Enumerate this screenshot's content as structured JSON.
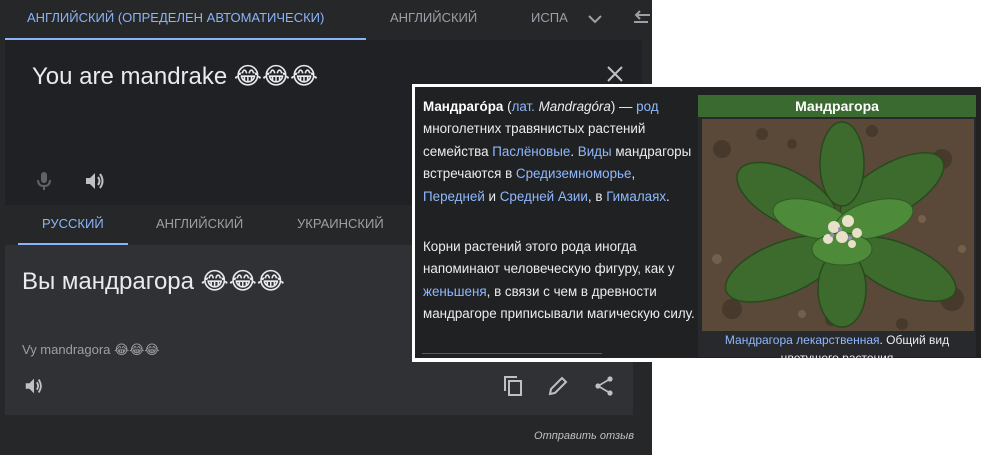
{
  "source_tabs": [
    {
      "label": "АНГЛИЙСКИЙ (ОПРЕДЕЛЕН АВТОМАТИЧЕСКИ)",
      "active": true
    },
    {
      "label": "АНГЛИЙСКИЙ",
      "active": false
    },
    {
      "label": "ИСПА",
      "active": false
    }
  ],
  "source_text": "You are mandrake 😂😂😂",
  "target_tabs": [
    {
      "label": "РУССКИЙ",
      "active": true
    },
    {
      "label": "АНГЛИЙСКИЙ",
      "active": false
    },
    {
      "label": "УКРАИНСКИЙ",
      "active": false
    }
  ],
  "translation_text": "Вы мандрагора 😂😂😂",
  "transliteration": "Vy mandragora 😂😂😂",
  "feedback_link": "Отправить отзыв",
  "wiki": {
    "p1": {
      "term": "Мандрагóра",
      "lat_open": " (",
      "lat_link": "лат.",
      "lat_term": " Mandragóra",
      "lat_close": ") — ",
      "genus_link": "род",
      "text1": " многолетних травянистых растений семейства ",
      "family_link": "Паслёновые",
      "text2": ". ",
      "species_link": "Виды",
      "text3": " мандрагоры встречаются в ",
      "region1_link": "Средиземноморье",
      "text4": ", ",
      "region2_link": "Передней",
      "text5": " и ",
      "region3_link": "Средней Азии",
      "text6": ", в ",
      "region4_link": "Гималаях",
      "text7": "."
    },
    "p2": {
      "text1": "Корни растений этого рода иногда напоминают человеческую фигуру, как у ",
      "ginseng_link": "женьшеня",
      "text2": ", в связи с чем в древности мандрагоре приписывали магическую силу."
    },
    "infobox": {
      "title": "Мандрагора",
      "caption_link": "Мандрагора лекарственная",
      "caption_text": ". Общий вид цветущего растения"
    }
  },
  "colors": {
    "accent": "#8ab4f8",
    "panel": "#262729",
    "infobox_header": "#3a6a30"
  }
}
